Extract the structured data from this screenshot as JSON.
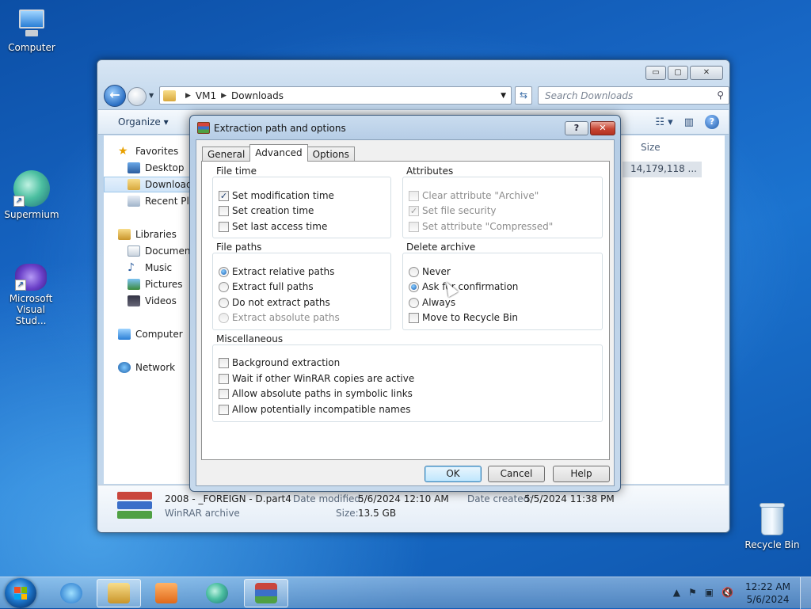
{
  "desktop": {
    "icons": [
      {
        "label": "Computer"
      },
      {
        "label": "Supermium"
      },
      {
        "label": "Microsoft Visual Stud..."
      },
      {
        "label": "Recycle Bin"
      }
    ]
  },
  "explorer": {
    "window_buttons": {
      "minimize": "▭",
      "maximize": "▢",
      "close": "✕"
    },
    "breadcrumb": [
      "VM1",
      "Downloads"
    ],
    "search_placeholder": "Search Downloads",
    "organize_label": "Organize ▾",
    "nav": {
      "favorites": "Favorites",
      "desktop": "Desktop",
      "downloads": "Downloads",
      "recent": "Recent Places",
      "libraries": "Libraries",
      "documents": "Documents",
      "music": "Music",
      "pictures": "Pictures",
      "videos": "Videos",
      "computer": "Computer",
      "network": "Network"
    },
    "column_size": "Size",
    "file_size_cell": "14,179,118 ...",
    "details": {
      "name": "2008 - _FOREIGN - D.part4",
      "type": "WinRAR archive",
      "date_modified_label": "Date modified:",
      "date_modified": "5/6/2024 12:10 AM",
      "date_created_label": "Date created:",
      "date_created": "5/5/2024 11:38 PM",
      "size_label": "Size:",
      "size": "13.5 GB"
    }
  },
  "dialog": {
    "title": "Extraction path and options",
    "help_btn": "?",
    "close_btn": "✕",
    "tabs": [
      "General",
      "Advanced",
      "Options"
    ],
    "active_tab": "Advanced",
    "file_time": {
      "title": "File time",
      "options": [
        {
          "label": "Set modification time",
          "checked": true
        },
        {
          "label": "Set creation time",
          "checked": false
        },
        {
          "label": "Set last access time",
          "checked": false
        }
      ]
    },
    "attributes": {
      "title": "Attributes",
      "options": [
        {
          "label": "Clear attribute \"Archive\"",
          "checked": false
        },
        {
          "label": "Set file security",
          "checked": true
        },
        {
          "label": "Set attribute \"Compressed\"",
          "checked": false
        }
      ]
    },
    "file_paths": {
      "title": "File paths",
      "options": [
        {
          "label": "Extract relative paths",
          "selected": true
        },
        {
          "label": "Extract full paths",
          "selected": false
        },
        {
          "label": "Do not extract paths",
          "selected": false
        },
        {
          "label": "Extract absolute paths",
          "selected": false
        }
      ]
    },
    "delete_archive": {
      "title": "Delete archive",
      "options": [
        {
          "label": "Never",
          "selected": false
        },
        {
          "label": "Ask for confirmation",
          "selected": true
        },
        {
          "label": "Always",
          "selected": false
        }
      ],
      "recycle": {
        "label": "Move to Recycle Bin",
        "checked": false
      }
    },
    "misc": {
      "title": "Miscellaneous",
      "options": [
        {
          "label": "Background extraction",
          "checked": false
        },
        {
          "label": "Wait if other WinRAR copies are active",
          "checked": false
        },
        {
          "label": "Allow absolute paths in symbolic links",
          "checked": false
        },
        {
          "label": "Allow potentially incompatible names",
          "checked": false
        }
      ]
    },
    "buttons": {
      "ok": "OK",
      "cancel": "Cancel",
      "help": "Help"
    }
  },
  "taskbar": {
    "time": "12:22 AM",
    "date": "5/6/2024"
  }
}
